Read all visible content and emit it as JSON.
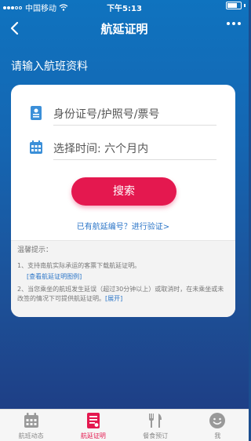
{
  "status_bar": {
    "carrier": "中国移动",
    "time": "下午5:13"
  },
  "nav": {
    "title": "航延证明"
  },
  "section_title": "请输入航班资料",
  "form": {
    "id_field_placeholder": "身份证号/护照号/票号",
    "time_label": "选择时间:",
    "time_value": "六个月内",
    "search_label": "搜索",
    "verify_link": "已有航延编号？进行验证>"
  },
  "tips": {
    "title": "温馨提示：",
    "item1": "1、支持南航实际承运的客票下载航延证明。",
    "item1_link": "[查看航延证明图例]",
    "item2": "2、当您乘坐的航班发生延误（超过30分钟以上）或取消时，在未乘坐或未改签的情况下可提供航延证明。",
    "item2_link": "[展开]"
  },
  "tabs": [
    {
      "label": "航班动态",
      "icon": "calendar-icon",
      "active": false
    },
    {
      "label": "航延证明",
      "icon": "document-icon",
      "active": true
    },
    {
      "label": "餐食预订",
      "icon": "meal-icon",
      "active": false
    },
    {
      "label": "我",
      "icon": "smiley-icon",
      "active": false
    }
  ],
  "colors": {
    "accent": "#e4184f",
    "link": "#2c76c8",
    "header_bg": "#0f73bf"
  }
}
